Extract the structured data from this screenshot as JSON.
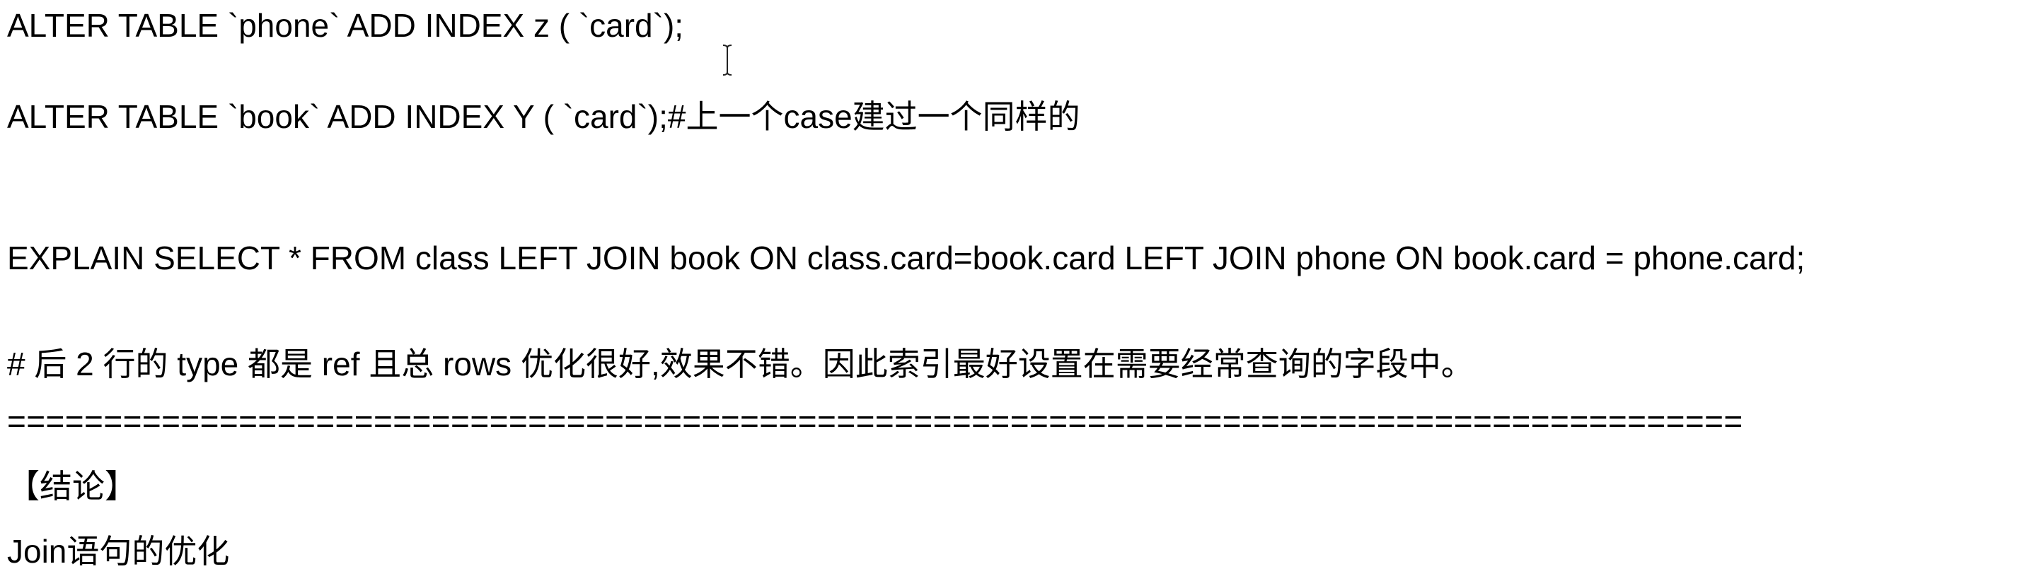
{
  "document": {
    "lines": [
      "ALTER TABLE `phone` ADD INDEX z ( `card`);",
      "ALTER TABLE `book` ADD INDEX Y ( `card`);#上一个case建过一个同样的",
      "EXPLAIN SELECT * FROM class LEFT JOIN book ON class.card=book.card LEFT JOIN phone ON book.card = phone.card;",
      "# 后 2 行的 type 都是 ref 且总 rows 优化很好,效果不错。因此索引最好设置在需要经常查询的字段中。",
      "==========================================================================================",
      "【结论】",
      "Join语句的优化"
    ]
  },
  "cursor": {
    "icon": "text-cursor-icon"
  }
}
